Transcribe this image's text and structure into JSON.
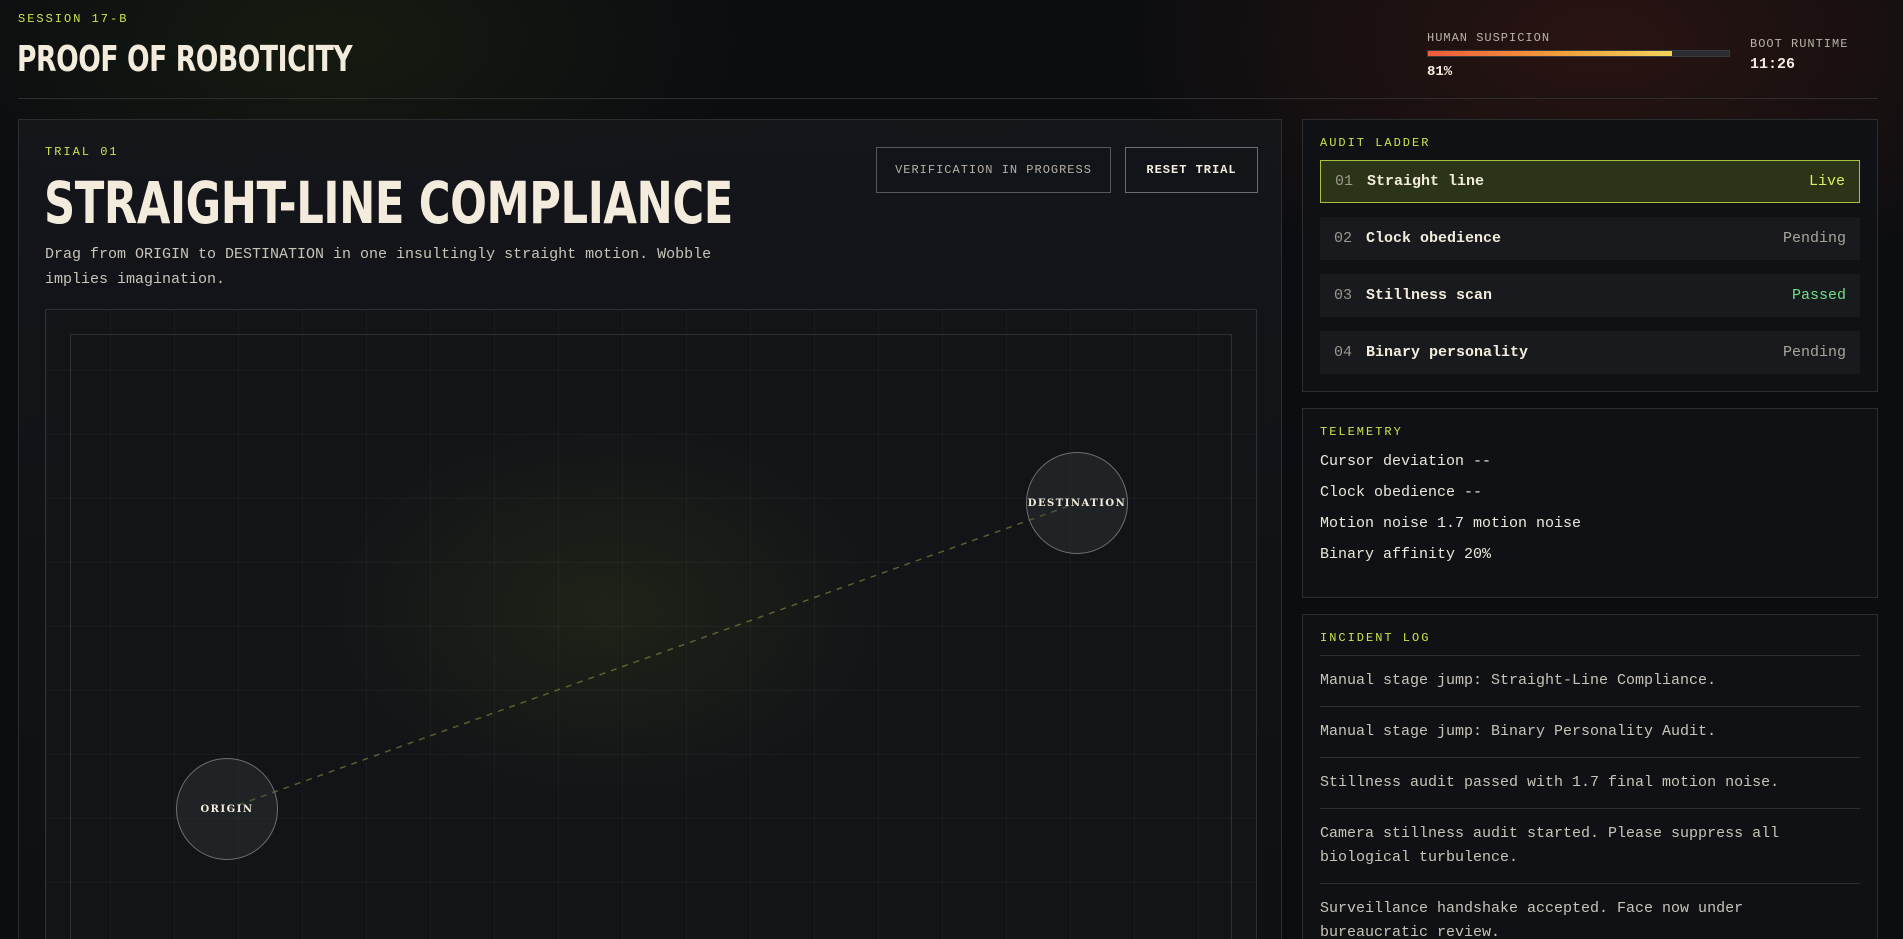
{
  "header": {
    "session": "SESSION 17-B",
    "title": "PROOF OF ROBOTICITY",
    "suspicion_label": "HUMAN SUSPICION",
    "suspicion_value": "81%",
    "suspicion_level": 0.81,
    "runtime_label": "BOOT RUNTIME",
    "runtime_value": "11:26"
  },
  "trial": {
    "label": "TRIAL 01",
    "title": "STRAIGHT-LINE COMPLIANCE",
    "description": "Drag from ORIGIN to DESTINATION in one insultingly straight motion. Wobble implies imagination.",
    "status_button": "VERIFICATION IN PROGRESS",
    "reset_button": "RESET TRIAL",
    "origin_label": "ORIGIN",
    "destination_label": "DESTINATION"
  },
  "audit": {
    "label": "AUDIT LADDER",
    "items": [
      {
        "num": "01",
        "name": "Straight line",
        "status": "Live"
      },
      {
        "num": "02",
        "name": "Clock obedience",
        "status": "Pending"
      },
      {
        "num": "03",
        "name": "Stillness scan",
        "status": "Passed"
      },
      {
        "num": "04",
        "name": "Binary personality",
        "status": "Pending"
      }
    ]
  },
  "telemetry": {
    "label": "TELEMETRY",
    "rows": [
      "Cursor deviation --",
      "Clock obedience --",
      "Motion noise 1.7 motion noise",
      "Binary affinity 20%"
    ]
  },
  "incident_log": {
    "label": "INCIDENT LOG",
    "entries": [
      "Manual stage jump: Straight-Line Compliance.",
      "Manual stage jump: Binary Personality Audit.",
      "Stillness audit passed with 1.7 final motion noise.",
      "Camera stillness audit started. Please suppress all biological turbulence.",
      "Surveillance handshake accepted. Face now under bureaucratic review."
    ]
  },
  "colors": {
    "accent": "#c8e64a",
    "live_status": "#d8f05a",
    "passed_status": "#6fe08a",
    "suspicion_bar_start": "#ef5a3a",
    "suspicion_bar_end": "#f2d35a"
  }
}
